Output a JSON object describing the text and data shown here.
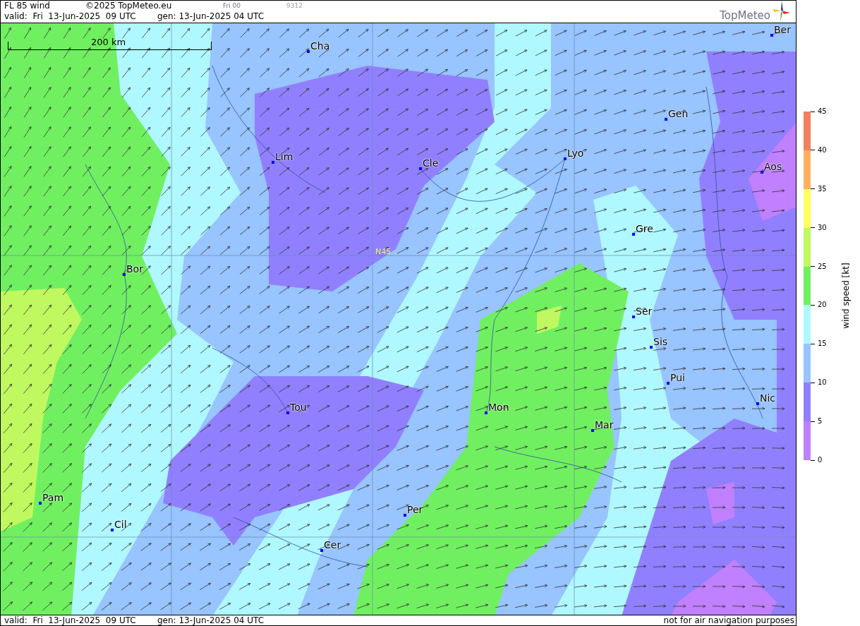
{
  "header": {
    "title": "FL 85 wind",
    "copyright": "©2025 TopMeteo.eu",
    "run": "Fri 00",
    "code": "9312",
    "valid": "valid:  Fri  13-Jun-2025  09 UTC",
    "generated": "gen: 13-Jun-2025 04 UTC",
    "logo": "TopMeteo"
  },
  "map": {
    "scale_label": "200 km",
    "latitude_label": "N45",
    "cities": [
      "Ber",
      "Cha",
      "Gen",
      "Lim",
      "Cle",
      "Lyo",
      "Aos",
      "Gre",
      "Bor",
      "Ser",
      "Sis",
      "Pui",
      "Nic",
      "Tou",
      "Mon",
      "Mar",
      "Pam",
      "Per",
      "Cil",
      "Cer"
    ]
  },
  "legend": {
    "title": "wind speed [kt]",
    "ticks": [
      "45",
      "40",
      "35",
      "30",
      "25",
      "20",
      "15",
      "10",
      "5",
      "0"
    ],
    "bands": [
      {
        "color": "#f08060"
      },
      {
        "color": "#ffb060"
      },
      {
        "color": "#ffff60"
      },
      {
        "color": "#c0f860"
      },
      {
        "color": "#70f060"
      },
      {
        "color": "#b0f8ff"
      },
      {
        "color": "#98c4ff"
      },
      {
        "color": "#9080ff"
      },
      {
        "color": "#c080ff"
      }
    ]
  },
  "footer": {
    "valid": "valid:  Fri  13-Jun-2025  09 UTC",
    "generated": "gen: 13-Jun-2025 04 UTC",
    "disclaimer": "not for air navigation purposes"
  }
}
